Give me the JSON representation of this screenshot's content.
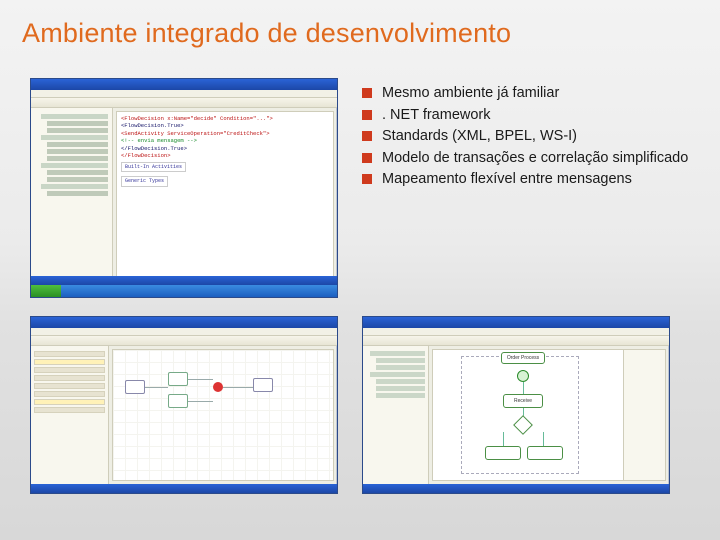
{
  "title": "Ambiente integrado de desenvolvimento",
  "bullets": [
    "Mesmo ambiente já familiar",
    ". NET framework",
    "Standards (XML, BPEL, WS-I)",
    "Modelo de transações e correlação simplificado",
    "Mapeamento flexível entre mensagens"
  ],
  "screenshots": {
    "code_editor": {
      "l1": "<FlowDecision x:Name=\"decide\" Condition=\"...\">",
      "l2": "  <FlowDecision.True>",
      "l3": "    <SendActivity ServiceOperation=\"CreditCheck\">",
      "l4": "      <!-- envia mensagem -->",
      "l5": "  </FlowDecision.True>",
      "l6": "</FlowDecision>",
      "btn1": "Built-In Activities",
      "btn2": "Generic Types"
    },
    "mapper": {},
    "workflow": {
      "node1": "Receive",
      "node2": "Order Process"
    }
  }
}
